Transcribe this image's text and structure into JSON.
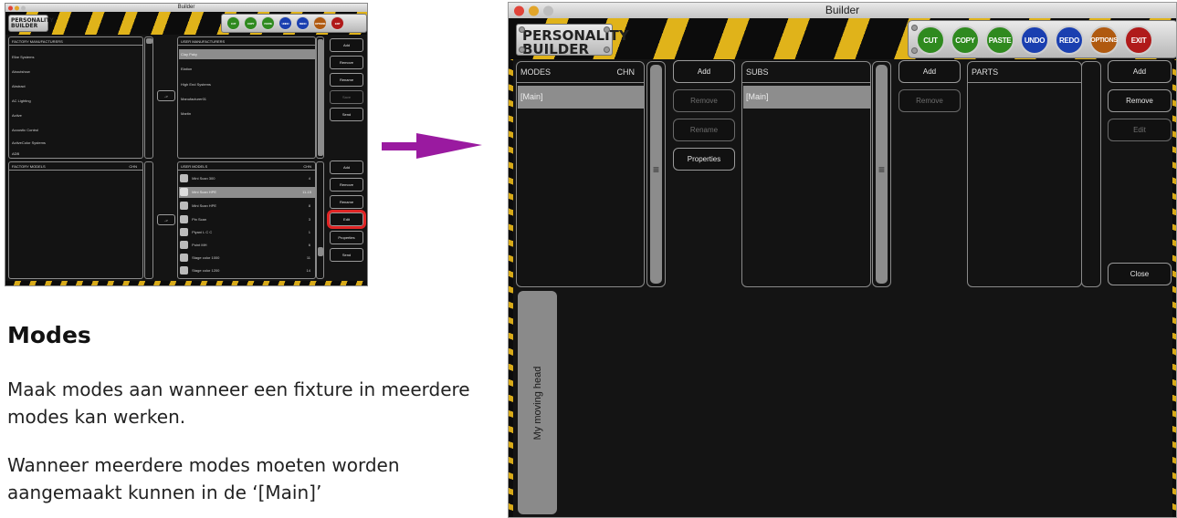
{
  "app": {
    "window_title": "Builder",
    "logo_line1": "PERSONALITY",
    "logo_line2": "BUILDER"
  },
  "toolbar": [
    {
      "label": "CUT",
      "color": "#2f8a1f"
    },
    {
      "label": "COPY",
      "color": "#2f8a1f"
    },
    {
      "label": "PASTE",
      "color": "#2f8a1f"
    },
    {
      "label": "UNDO",
      "color": "#1a3fb0"
    },
    {
      "label": "REDO",
      "color": "#1a3fb0"
    },
    {
      "label": "OPTIONS",
      "color": "#b05a10"
    },
    {
      "label": "EXIT",
      "color": "#b01a1a"
    }
  ],
  "thumbnail": {
    "factory_manufacturers": {
      "header": "FACTORY MANUFACTURERS",
      "items": [
        "Ellar Systems",
        "Aboutshow",
        "Abstract",
        "AC Lighting",
        "Active",
        "Acoustic Control",
        "ActiveColor Systems",
        "ADB"
      ]
    },
    "user_manufacturers": {
      "header": "USER MANUFACTURERS",
      "items": [
        "Clay Paky",
        "Elation",
        "High End Systems",
        "Manufacturer01",
        "Martin"
      ],
      "selected_index": 0
    },
    "top_buttons": [
      "Add",
      "Remove",
      "Rename",
      "Save",
      "Send"
    ],
    "factory_models": {
      "header": "FACTORY MODELS",
      "chn": "CHN"
    },
    "user_models": {
      "header": "USER MODELS",
      "chn": "CHN",
      "items": [
        {
          "name": "Mini Scan 300",
          "chn": "4"
        },
        {
          "name": "Mini Scan HPE",
          "chn": "11-15"
        },
        {
          "name": "Mini Scan HPE",
          "chn": "8"
        },
        {
          "name": "Pin Scan",
          "chn": "3"
        },
        {
          "name": "Piyani L C C",
          "chn": "1"
        },
        {
          "name": "Point MH",
          "chn": "6"
        },
        {
          "name": "Stage color 1000",
          "chn": "11"
        },
        {
          "name": "Stage color 1200",
          "chn": "14"
        }
      ],
      "selected_index": 1
    },
    "bottom_buttons": [
      "Add",
      "Remove",
      "Rename",
      "Edit",
      "Properties",
      "Send"
    ],
    "arrow_buttons": [
      "->",
      "->"
    ]
  },
  "text": {
    "heading": "Modes",
    "para1": "Maak modes aan wanneer een fixture in meerdere modes kan werken.",
    "para2": "Wanneer meerdere modes moeten worden aangemaakt kunnen in de ‘[Main]’"
  },
  "builder": {
    "modes": {
      "header": "MODES",
      "chn": "CHN",
      "items": [
        "[Main]"
      ]
    },
    "modes_buttons": [
      {
        "label": "Add",
        "enabled": true
      },
      {
        "label": "Remove",
        "enabled": false
      },
      {
        "label": "Rename",
        "enabled": false
      },
      {
        "label": "Properties",
        "enabled": true
      }
    ],
    "subs": {
      "header": "SUBS",
      "items": [
        "[Main]"
      ]
    },
    "subs_buttons": [
      {
        "label": "Add",
        "enabled": true
      },
      {
        "label": "Remove",
        "enabled": false
      }
    ],
    "parts": {
      "header": "PARTS"
    },
    "parts_buttons": [
      {
        "label": "Add",
        "enabled": true
      },
      {
        "label": "Remove",
        "enabled": true
      },
      {
        "label": "Edit",
        "enabled": false
      }
    ],
    "close_label": "Close",
    "fixture_tab": "My moving head",
    "grip": "≡"
  }
}
